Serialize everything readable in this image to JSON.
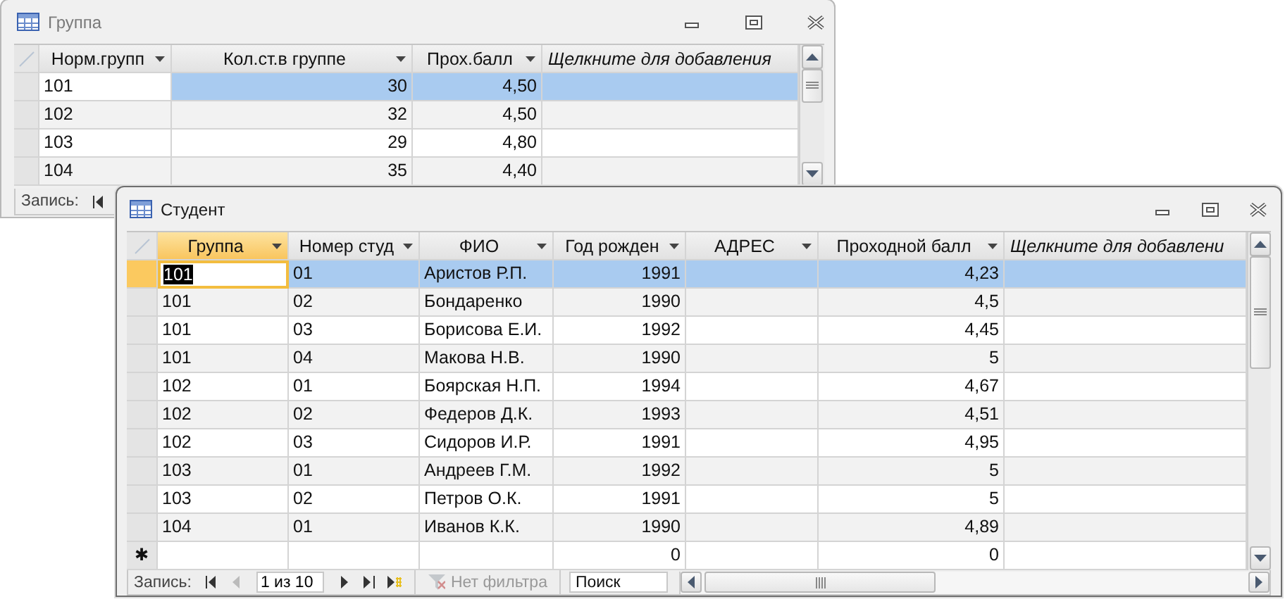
{
  "windows": [
    {
      "title": "Группа",
      "active": false,
      "columns": [
        {
          "label": "Норм.групп",
          "kind": "text",
          "current": true
        },
        {
          "label": "Кол.ст.в группе",
          "kind": "number",
          "current": false
        },
        {
          "label": "Прох.балл",
          "kind": "number",
          "current": false
        },
        {
          "label": "Щелкните для добавления",
          "kind": "add",
          "current": false
        }
      ],
      "rows": [
        {
          "kind": "record",
          "selected": true,
          "cells": [
            "101",
            "30",
            "4,50",
            null
          ]
        },
        {
          "kind": "record",
          "selected": false,
          "cells": [
            "102",
            "32",
            "4,50",
            null
          ]
        },
        {
          "kind": "record",
          "selected": false,
          "cells": [
            "103",
            "29",
            "4,80",
            null
          ]
        },
        {
          "kind": "record",
          "selected": false,
          "cells": [
            "104",
            "35",
            "4,40",
            null
          ]
        }
      ],
      "nav": {
        "label": "Запись:"
      }
    },
    {
      "title": "Студент",
      "active": true,
      "columns": [
        {
          "label": "Группа",
          "kind": "text",
          "current": true
        },
        {
          "label": "Номер студ",
          "kind": "text",
          "current": false
        },
        {
          "label": "ФИО",
          "kind": "text",
          "current": false
        },
        {
          "label": "Год рожден",
          "kind": "number",
          "current": false
        },
        {
          "label": "АДРЕС",
          "kind": "text",
          "current": false
        },
        {
          "label": "Проходной балл",
          "kind": "number",
          "current": false
        },
        {
          "label": "Щелкните для добавлени",
          "kind": "add",
          "current": false
        }
      ],
      "rows": [
        {
          "kind": "record",
          "selected": true,
          "cells": [
            "101",
            "01",
            "Аристов Р.П.",
            "1991",
            null,
            "4,23",
            null
          ]
        },
        {
          "kind": "record",
          "selected": false,
          "cells": [
            "101",
            "02",
            "Бондаренко",
            "1990",
            null,
            "4,5",
            null
          ]
        },
        {
          "kind": "record",
          "selected": false,
          "cells": [
            "101",
            "03",
            "Борисова Е.И.",
            "1992",
            null,
            "4,45",
            null
          ]
        },
        {
          "kind": "record",
          "selected": false,
          "cells": [
            "101",
            "04",
            "Макова Н.В.",
            "1990",
            null,
            "5",
            null
          ]
        },
        {
          "kind": "record",
          "selected": false,
          "cells": [
            "102",
            "01",
            "Боярская Н.П.",
            "1994",
            null,
            "4,67",
            null
          ]
        },
        {
          "kind": "record",
          "selected": false,
          "cells": [
            "102",
            "02",
            "Федеров Д.К.",
            "1993",
            null,
            "4,51",
            null
          ]
        },
        {
          "kind": "record",
          "selected": false,
          "cells": [
            "102",
            "03",
            "Сидоров И.Р.",
            "1991",
            null,
            "4,95",
            null
          ]
        },
        {
          "kind": "record",
          "selected": false,
          "cells": [
            "103",
            "01",
            "Андреев Г.М.",
            "1992",
            null,
            "5",
            null
          ]
        },
        {
          "kind": "record",
          "selected": false,
          "cells": [
            "103",
            "02",
            "Петров О.К.",
            "1991",
            null,
            "5",
            null
          ]
        },
        {
          "kind": "record",
          "selected": false,
          "cells": [
            "104",
            "01",
            "Иванов К.К.",
            "1990",
            null,
            "4,89",
            null
          ]
        },
        {
          "kind": "new",
          "marker": "✱",
          "selected": false,
          "cells": [
            null,
            null,
            null,
            "0",
            null,
            "0",
            null
          ]
        }
      ],
      "nav": {
        "label": "Запись:",
        "position": "1 из 10",
        "filter": "Нет фильтра",
        "filter_active": false,
        "search_placeholder": "Поиск"
      }
    }
  ]
}
